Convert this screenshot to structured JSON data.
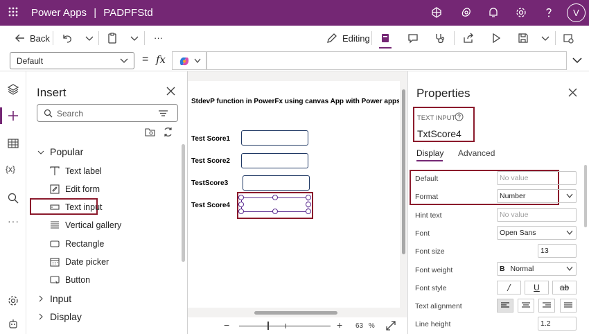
{
  "app": {
    "name": "Power Apps",
    "separator": "|",
    "file": "PADPFStd",
    "avatar": "V"
  },
  "commandbar": {
    "back": "Back",
    "editing": "Editing",
    "more": "···"
  },
  "formulabar": {
    "property": "Default",
    "equals": "=",
    "fx": "fx"
  },
  "insert": {
    "title": "Insert",
    "search_placeholder": "Search",
    "items": [
      {
        "label": "Popular",
        "kind": "group-open"
      },
      {
        "label": "Text label",
        "icon": "text-label-icon"
      },
      {
        "label": "Edit form",
        "icon": "edit-form-icon"
      },
      {
        "label": "Text input",
        "icon": "text-input-icon"
      },
      {
        "label": "Vertical gallery",
        "icon": "gallery-icon"
      },
      {
        "label": "Rectangle",
        "icon": "rectangle-icon"
      },
      {
        "label": "Date picker",
        "icon": "calendar-icon"
      },
      {
        "label": "Button",
        "icon": "button-icon"
      },
      {
        "label": "Input",
        "kind": "group"
      },
      {
        "label": "Display",
        "kind": "group"
      }
    ]
  },
  "canvas": {
    "heading": "StdevP function in PowerFx using canvas App with Power apps",
    "rows": [
      "Test Score1",
      "Test Score2",
      "TestScore3",
      "Test Score4"
    ],
    "zoom": "63",
    "zoom_unit": "%"
  },
  "properties": {
    "title": "Properties",
    "control_type": "TEXT INPUT",
    "control_name": "TxtScore4",
    "tabs": [
      "Display",
      "Advanced"
    ],
    "rows": [
      {
        "label": "Default",
        "value": "No value",
        "placeholder": true
      },
      {
        "label": "Format",
        "value": "Number",
        "dropdown": true
      },
      {
        "label": "Hint text",
        "value": "No value",
        "placeholder": true
      },
      {
        "label": "Font",
        "value": "Open Sans",
        "dropdown": true
      },
      {
        "label": "Font size",
        "value": "13"
      },
      {
        "label": "Font weight",
        "value": "Normal",
        "dropdown": true,
        "prefix": "B"
      },
      {
        "label": "Font style",
        "value": ""
      },
      {
        "label": "Text alignment",
        "value": ""
      },
      {
        "label": "Line height",
        "value": "1.2"
      }
    ]
  },
  "colors": {
    "brand": "#742774",
    "highlight": "#8b1a2c",
    "input_border": "#1f3864"
  }
}
